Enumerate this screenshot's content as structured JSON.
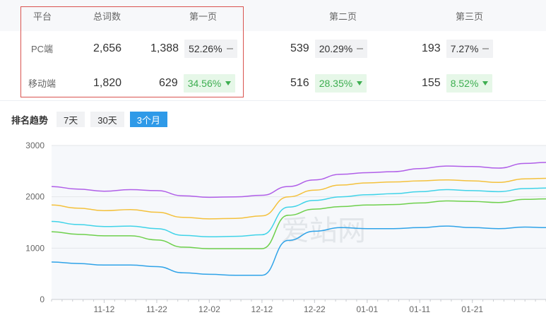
{
  "table": {
    "headers": [
      "平台",
      "总词数",
      "第一页",
      "第二页",
      "第三页"
    ],
    "rows": [
      {
        "platform": "PC端",
        "total": "2,656",
        "p1": {
          "count": "1,388",
          "pct": "52.26%",
          "trend": "flat"
        },
        "p2": {
          "count": "539",
          "pct": "20.29%",
          "trend": "flat"
        },
        "p3": {
          "count": "193",
          "pct": "7.27%",
          "trend": "flat"
        }
      },
      {
        "platform": "移动端",
        "total": "1,820",
        "p1": {
          "count": "629",
          "pct": "34.56%",
          "trend": "down"
        },
        "p2": {
          "count": "516",
          "pct": "28.35%",
          "trend": "down"
        },
        "p3": {
          "count": "155",
          "pct": "8.52%",
          "trend": "down"
        }
      }
    ]
  },
  "trend": {
    "label": "排名趋势",
    "ranges": [
      "7天",
      "30天",
      "3个月"
    ],
    "active": "3个月"
  },
  "colors": {
    "accent": "#2f9ae8",
    "green": "#3dae50",
    "red_box": "#d9534f"
  },
  "chart_data": {
    "type": "line",
    "watermark": "爱站网",
    "ylim": [
      0,
      3000
    ],
    "yticks": [
      0,
      1000,
      2000,
      3000
    ],
    "xticks": [
      "11-12",
      "11-22",
      "12-02",
      "12-12",
      "12-22",
      "01-01",
      "01-11",
      "01-21"
    ],
    "x_days": [
      0,
      5,
      10,
      15,
      20,
      25,
      30,
      35,
      40,
      45,
      50,
      55,
      60,
      65,
      70,
      75,
      80,
      85,
      90,
      94
    ],
    "series": [
      {
        "color": "#b05ee8",
        "values": [
          2200,
          2150,
          2110,
          2140,
          2120,
          2020,
          1990,
          2000,
          2030,
          2200,
          2330,
          2440,
          2470,
          2490,
          2550,
          2600,
          2590,
          2560,
          2650,
          2670
        ]
      },
      {
        "color": "#f4c13c",
        "values": [
          1840,
          1780,
          1730,
          1750,
          1700,
          1600,
          1570,
          1580,
          1630,
          2000,
          2130,
          2230,
          2270,
          2290,
          2310,
          2330,
          2310,
          2280,
          2350,
          2360
        ]
      },
      {
        "color": "#3fd3e8",
        "values": [
          1520,
          1460,
          1420,
          1430,
          1380,
          1250,
          1220,
          1230,
          1260,
          1800,
          1930,
          2000,
          2040,
          2060,
          2100,
          2140,
          2120,
          2100,
          2160,
          2170
        ]
      },
      {
        "color": "#6ed04c",
        "values": [
          1320,
          1270,
          1240,
          1240,
          1160,
          1020,
          990,
          990,
          990,
          1640,
          1760,
          1810,
          1840,
          1850,
          1880,
          1920,
          1910,
          1890,
          1950,
          1960
        ]
      },
      {
        "color": "#2fa3e8",
        "values": [
          730,
          700,
          670,
          670,
          640,
          520,
          490,
          470,
          470,
          1150,
          1330,
          1400,
          1380,
          1380,
          1400,
          1430,
          1400,
          1380,
          1410,
          1400
        ]
      }
    ]
  }
}
